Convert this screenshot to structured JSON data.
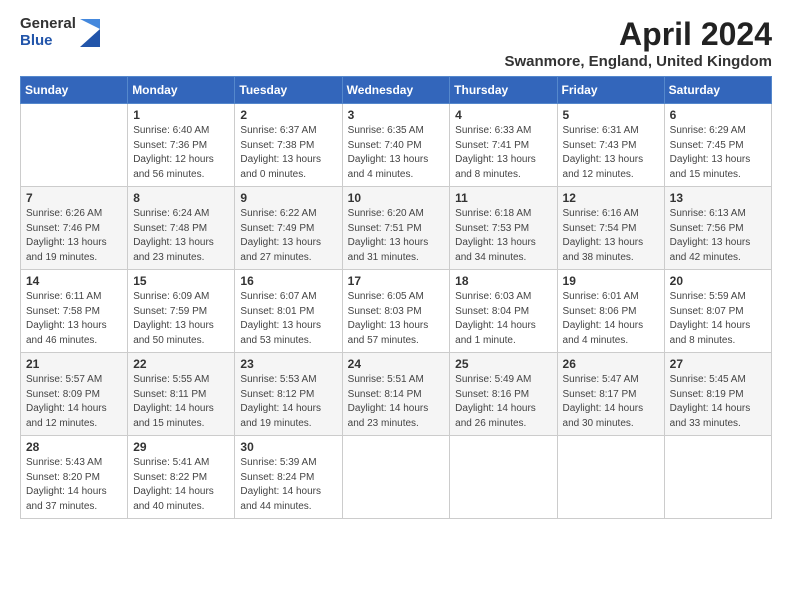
{
  "header": {
    "logo_general": "General",
    "logo_blue": "Blue",
    "month_title": "April 2024",
    "subtitle": "Swanmore, England, United Kingdom"
  },
  "days_of_week": [
    "Sunday",
    "Monday",
    "Tuesday",
    "Wednesday",
    "Thursday",
    "Friday",
    "Saturday"
  ],
  "weeks": [
    [
      {
        "day": "",
        "info": ""
      },
      {
        "day": "1",
        "info": "Sunrise: 6:40 AM\nSunset: 7:36 PM\nDaylight: 12 hours\nand 56 minutes."
      },
      {
        "day": "2",
        "info": "Sunrise: 6:37 AM\nSunset: 7:38 PM\nDaylight: 13 hours\nand 0 minutes."
      },
      {
        "day": "3",
        "info": "Sunrise: 6:35 AM\nSunset: 7:40 PM\nDaylight: 13 hours\nand 4 minutes."
      },
      {
        "day": "4",
        "info": "Sunrise: 6:33 AM\nSunset: 7:41 PM\nDaylight: 13 hours\nand 8 minutes."
      },
      {
        "day": "5",
        "info": "Sunrise: 6:31 AM\nSunset: 7:43 PM\nDaylight: 13 hours\nand 12 minutes."
      },
      {
        "day": "6",
        "info": "Sunrise: 6:29 AM\nSunset: 7:45 PM\nDaylight: 13 hours\nand 15 minutes."
      }
    ],
    [
      {
        "day": "7",
        "info": "Sunrise: 6:26 AM\nSunset: 7:46 PM\nDaylight: 13 hours\nand 19 minutes."
      },
      {
        "day": "8",
        "info": "Sunrise: 6:24 AM\nSunset: 7:48 PM\nDaylight: 13 hours\nand 23 minutes."
      },
      {
        "day": "9",
        "info": "Sunrise: 6:22 AM\nSunset: 7:49 PM\nDaylight: 13 hours\nand 27 minutes."
      },
      {
        "day": "10",
        "info": "Sunrise: 6:20 AM\nSunset: 7:51 PM\nDaylight: 13 hours\nand 31 minutes."
      },
      {
        "day": "11",
        "info": "Sunrise: 6:18 AM\nSunset: 7:53 PM\nDaylight: 13 hours\nand 34 minutes."
      },
      {
        "day": "12",
        "info": "Sunrise: 6:16 AM\nSunset: 7:54 PM\nDaylight: 13 hours\nand 38 minutes."
      },
      {
        "day": "13",
        "info": "Sunrise: 6:13 AM\nSunset: 7:56 PM\nDaylight: 13 hours\nand 42 minutes."
      }
    ],
    [
      {
        "day": "14",
        "info": "Sunrise: 6:11 AM\nSunset: 7:58 PM\nDaylight: 13 hours\nand 46 minutes."
      },
      {
        "day": "15",
        "info": "Sunrise: 6:09 AM\nSunset: 7:59 PM\nDaylight: 13 hours\nand 50 minutes."
      },
      {
        "day": "16",
        "info": "Sunrise: 6:07 AM\nSunset: 8:01 PM\nDaylight: 13 hours\nand 53 minutes."
      },
      {
        "day": "17",
        "info": "Sunrise: 6:05 AM\nSunset: 8:03 PM\nDaylight: 13 hours\nand 57 minutes."
      },
      {
        "day": "18",
        "info": "Sunrise: 6:03 AM\nSunset: 8:04 PM\nDaylight: 14 hours\nand 1 minute."
      },
      {
        "day": "19",
        "info": "Sunrise: 6:01 AM\nSunset: 8:06 PM\nDaylight: 14 hours\nand 4 minutes."
      },
      {
        "day": "20",
        "info": "Sunrise: 5:59 AM\nSunset: 8:07 PM\nDaylight: 14 hours\nand 8 minutes."
      }
    ],
    [
      {
        "day": "21",
        "info": "Sunrise: 5:57 AM\nSunset: 8:09 PM\nDaylight: 14 hours\nand 12 minutes."
      },
      {
        "day": "22",
        "info": "Sunrise: 5:55 AM\nSunset: 8:11 PM\nDaylight: 14 hours\nand 15 minutes."
      },
      {
        "day": "23",
        "info": "Sunrise: 5:53 AM\nSunset: 8:12 PM\nDaylight: 14 hours\nand 19 minutes."
      },
      {
        "day": "24",
        "info": "Sunrise: 5:51 AM\nSunset: 8:14 PM\nDaylight: 14 hours\nand 23 minutes."
      },
      {
        "day": "25",
        "info": "Sunrise: 5:49 AM\nSunset: 8:16 PM\nDaylight: 14 hours\nand 26 minutes."
      },
      {
        "day": "26",
        "info": "Sunrise: 5:47 AM\nSunset: 8:17 PM\nDaylight: 14 hours\nand 30 minutes."
      },
      {
        "day": "27",
        "info": "Sunrise: 5:45 AM\nSunset: 8:19 PM\nDaylight: 14 hours\nand 33 minutes."
      }
    ],
    [
      {
        "day": "28",
        "info": "Sunrise: 5:43 AM\nSunset: 8:20 PM\nDaylight: 14 hours\nand 37 minutes."
      },
      {
        "day": "29",
        "info": "Sunrise: 5:41 AM\nSunset: 8:22 PM\nDaylight: 14 hours\nand 40 minutes."
      },
      {
        "day": "30",
        "info": "Sunrise: 5:39 AM\nSunset: 8:24 PM\nDaylight: 14 hours\nand 44 minutes."
      },
      {
        "day": "",
        "info": ""
      },
      {
        "day": "",
        "info": ""
      },
      {
        "day": "",
        "info": ""
      },
      {
        "day": "",
        "info": ""
      }
    ]
  ]
}
